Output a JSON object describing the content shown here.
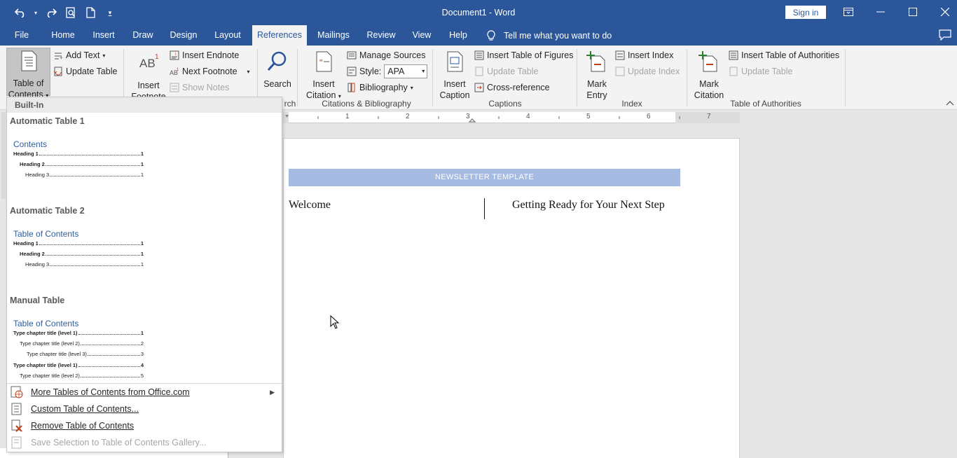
{
  "app": {
    "title": "Document1  -  Word",
    "signin": "Sign in"
  },
  "quick_access": {
    "icons": [
      "undo-icon",
      "redo-icon",
      "print-preview-icon",
      "new-document-icon",
      "customize-icon"
    ]
  },
  "tabs": [
    {
      "label": "File"
    },
    {
      "label": "Home"
    },
    {
      "label": "Insert"
    },
    {
      "label": "Draw"
    },
    {
      "label": "Design"
    },
    {
      "label": "Layout"
    },
    {
      "label": "References"
    },
    {
      "label": "Mailings"
    },
    {
      "label": "Review"
    },
    {
      "label": "View"
    },
    {
      "label": "Help"
    }
  ],
  "active_tab": "References",
  "tell_me": "Tell me what you want to do",
  "ribbon": {
    "toc": {
      "line1": "Table of",
      "line2": "Contents"
    },
    "add_text": "Add Text",
    "update_table": "Update Table",
    "insert_footnote": {
      "line1": "Insert",
      "line2": "Footnote"
    },
    "insert_endnote": "Insert Endnote",
    "next_footnote": "Next Footnote",
    "show_notes": "Show Notes",
    "search": "Search",
    "search_group_fragment": "rch",
    "insert_citation": {
      "line1": "Insert",
      "line2": "Citation"
    },
    "manage_sources": "Manage Sources",
    "style_label": "Style:",
    "style_value": "APA",
    "bibliography": "Bibliography",
    "citations_group": "Citations & Bibliography",
    "insert_caption": {
      "line1": "Insert",
      "line2": "Caption"
    },
    "insert_table_of_figures": "Insert Table of Figures",
    "update_table_captions": "Update Table",
    "cross_reference": "Cross-reference",
    "captions_group": "Captions",
    "mark_entry": {
      "line1": "Mark",
      "line2": "Entry"
    },
    "insert_index": "Insert Index",
    "update_index": "Update Index",
    "index_group": "Index",
    "mark_citation": {
      "line1": "Mark",
      "line2": "Citation"
    },
    "insert_table_of_authorities": "Insert Table of Authorities",
    "update_table_authorities": "Update Table",
    "authorities_group": "Table of Authorities"
  },
  "ruler": {
    "numbers": [
      "1",
      "2",
      "3",
      "4",
      "5",
      "6",
      "7"
    ]
  },
  "document": {
    "banner": "NEWSLETTER TEMPLATE",
    "welcome": "Welcome",
    "next_step": "Getting Ready for Your Next Step"
  },
  "toc_gallery": {
    "header": "Built-In",
    "items": [
      {
        "title": "Automatic Table 1",
        "heading": "Contents",
        "lines": [
          {
            "text": "Heading 1",
            "page": "1"
          },
          {
            "text": "Heading 2",
            "page": "1"
          },
          {
            "text": "Heading 3",
            "page": "1"
          }
        ]
      },
      {
        "title": "Automatic Table 2",
        "heading": "Table of Contents",
        "lines": [
          {
            "text": "Heading 1",
            "page": "1"
          },
          {
            "text": "Heading 2",
            "page": "1"
          },
          {
            "text": "Heading 3",
            "page": "1"
          }
        ]
      },
      {
        "title": "Manual Table",
        "heading": "Table of Contents",
        "lines": [
          {
            "text": "Type chapter title (level 1)",
            "page": "1"
          },
          {
            "text": "Type chapter title (level 2)",
            "page": "2"
          },
          {
            "text": "Type chapter title (level 3)",
            "page": "3"
          },
          {
            "text": "Type chapter title (level 1)",
            "page": "4"
          },
          {
            "text": "Type chapter title (level 2)",
            "page": "5"
          }
        ]
      }
    ],
    "commands": [
      {
        "label": "More Tables of Contents from Office.com",
        "enabled": true
      },
      {
        "label": "Custom Table of Contents...",
        "enabled": true
      },
      {
        "label": "Remove Table of Contents",
        "enabled": true
      },
      {
        "label": "Save Selection to Table of Contents Gallery...",
        "enabled": false
      }
    ]
  },
  "colors": {
    "word_blue": "#2b579a",
    "toc_heading_blue": "#2e5d9f",
    "banner_blue": "#a5bbe2"
  }
}
